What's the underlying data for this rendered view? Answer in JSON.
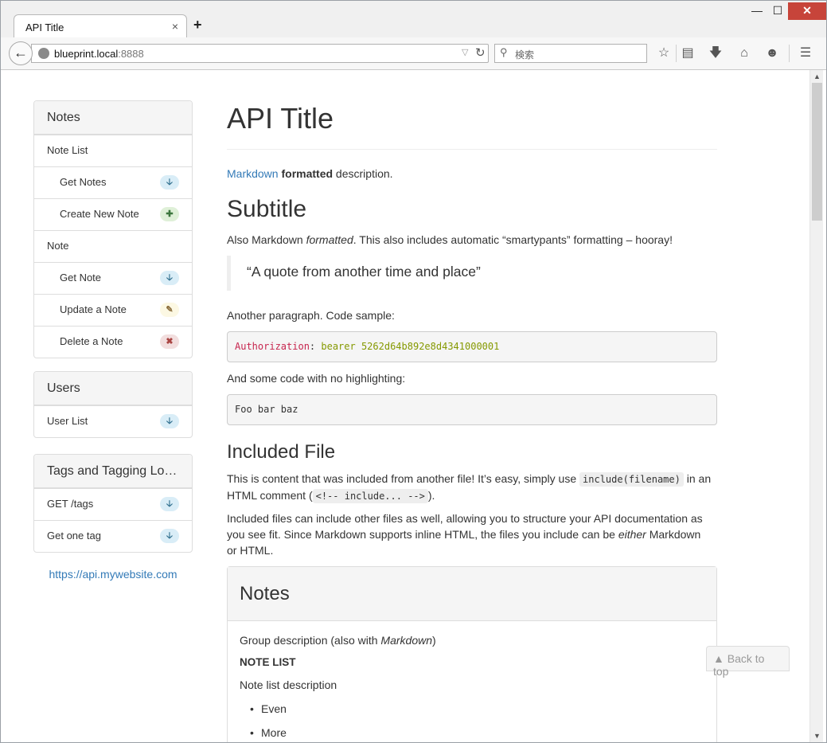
{
  "browser": {
    "tab_title": "API Title",
    "tab_close": "×",
    "new_tab": "+",
    "url_host": "blueprint.local",
    "url_port": ":8888",
    "search_placeholder": "検索"
  },
  "sidebar": {
    "groups": [
      {
        "title": "Notes",
        "items": [
          {
            "label": "Note List"
          },
          {
            "label": "Get Notes",
            "method": "GET"
          },
          {
            "label": "Create New Note",
            "method": "POST"
          },
          {
            "label": "Note"
          },
          {
            "label": "Get Note",
            "method": "GET"
          },
          {
            "label": "Update a Note",
            "method": "PUT"
          },
          {
            "label": "Delete a Note",
            "method": "DELETE"
          }
        ]
      },
      {
        "title": "Users",
        "items": [
          {
            "label": "User List",
            "method": "GET"
          }
        ]
      },
      {
        "title": "Tags and Tagging Long…",
        "items": [
          {
            "label": "GET /tags",
            "method": "GET"
          },
          {
            "label": "Get one tag",
            "method": "GET"
          }
        ]
      }
    ],
    "host_link": "https://api.mywebsite.com"
  },
  "content": {
    "title": "API Title",
    "intro_link": "Markdown",
    "intro_bold": "formatted",
    "intro_rest": " description.",
    "subtitle": "Subtitle",
    "sub_p_1": "Also Markdown ",
    "sub_p_em": "formatted",
    "sub_p_2": ". This also includes automatic “smartypants” formatting – hooray!",
    "quote": "“A quote from another time and place”",
    "para_code": "Another paragraph. Code sample:",
    "code_key": "Authorization",
    "code_colon": ": ",
    "code_val": "bearer 5262d64b892e8d4341000001",
    "para_nohl": "And some code with no highlighting:",
    "code_plain": "Foo bar baz",
    "included_title": "Included File",
    "inc_p1_a": "This is content that was included from another file! It’s easy, simply use ",
    "inc_p1_code": "include(filename)",
    "inc_p1_b": " in an",
    "inc_p1_c": "HTML comment (",
    "inc_p1_code2": "<!-- include... -->",
    "inc_p1_d": ").",
    "inc_p2_line1": "Included files can include other files as well, allowing you to structure your API documentation as",
    "inc_p2_line2a": "you see fit. Since Markdown supports inline HTML, the files you include can be ",
    "inc_p2_em": "either",
    "inc_p2_line2b": " Markdown",
    "inc_p2_line3": "or HTML.",
    "group": {
      "title": "Notes",
      "desc_a": "Group description (also with ",
      "desc_em": "Markdown",
      "desc_b": ")",
      "resource": "NOTE LIST",
      "resource_desc": "Note list description",
      "bullets": [
        "Even",
        "More"
      ]
    }
  },
  "back_to_top": "Back to top",
  "colors": {
    "link": "#337ab7",
    "get": "#d9edf7",
    "post": "#dff0d8",
    "put": "#fcf8e3",
    "delete": "#f2dede"
  }
}
